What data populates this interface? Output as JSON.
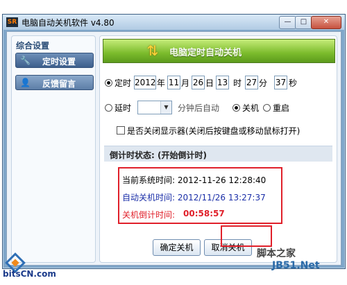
{
  "window": {
    "icon_text": "SR",
    "title": "电脑自动关机软件 v4.80",
    "min_glyph": "—",
    "max_glyph": "□",
    "close_glyph": "✕"
  },
  "sidebar": {
    "header": "综合设置",
    "items": [
      {
        "label": "定时设置",
        "icon": "wrench-icon",
        "glyph": "🔧"
      },
      {
        "label": "反馈留言",
        "icon": "user-icon",
        "glyph": "👤"
      }
    ]
  },
  "banner": {
    "title": "电脑定时自动关机",
    "icon": "arrows-icon",
    "glyph": "⇅"
  },
  "scheduled": {
    "radio_label": "定时",
    "year": "2012",
    "year_unit": "年",
    "month": "11",
    "month_unit": "月",
    "day": "26",
    "day_unit": "日",
    "hour": "13",
    "hour_unit": "时",
    "minute": "27",
    "minute_unit": "分",
    "second": "37",
    "second_unit": "秒"
  },
  "delay": {
    "radio_label": "延时",
    "value": "",
    "suffix": "分钟后自动",
    "action_shutdown": "关机",
    "action_restart": "重启"
  },
  "monitor_option": {
    "label": "是否关闭显示器(关闭后按键盘或移动鼠标打开)"
  },
  "status": {
    "label": "倒计时状态: (开始倒计时)"
  },
  "readout": {
    "current_time": "当前系统时间:  2012-11-26 12:28:40",
    "shutdown_time": "自动关机时间:  2012/11/26 13:27:37",
    "countdown_label": "关机倒计时间:",
    "countdown_value": "00:58:57"
  },
  "buttons": {
    "confirm": "确定关机",
    "cancel": "取消关机"
  },
  "watermarks": {
    "left": "bitsCN.com",
    "right_a": "脚本之家",
    "right_b": "JB51.Net"
  },
  "colors": {
    "current_time": "#000000",
    "shutdown_time": "#1b2fa8",
    "countdown": "#e0202a",
    "highlight_frame": "#e0202a"
  }
}
